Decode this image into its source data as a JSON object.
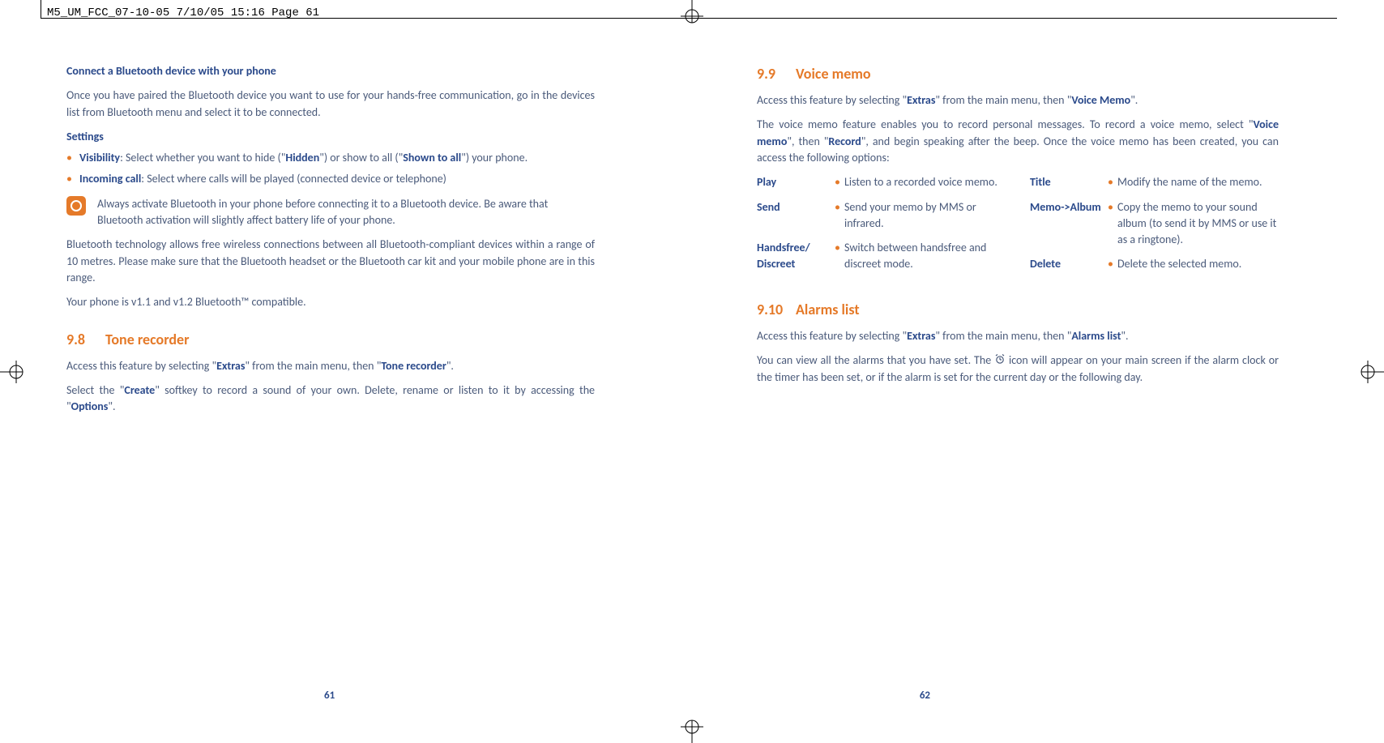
{
  "header": "M5_UM_FCC_07-10-05  7/10/05  15:16  Page 61",
  "left": {
    "h_connect": "Connect a Bluetooth device with your phone",
    "p_connect": "Once you have paired the Bluetooth device you want to use for your hands-free communication, go in the devices list from Bluetooth menu and select it to be connected.",
    "h_settings": "Settings",
    "vis_label": "Visibility",
    "vis_txt1": ": Select whether you want to hide (\"",
    "vis_hidden": "Hidden",
    "vis_txt2": "\") or show to all (\"",
    "vis_shown": "Shown to all",
    "vis_txt3": "\") your phone.",
    "inc_label": "Incoming call",
    "inc_txt": ": Select where calls will be played (connected device or telephone)",
    "tip": "Always activate Bluetooth in your phone before connecting it to a Bluetooth device. Be aware that Bluetooth activation will slightly affect battery life of your phone.",
    "p_bt_range": "Bluetooth technology allows free wireless connections between all Bluetooth-compliant devices within a range of 10 metres. Please make sure that the Bluetooth headset or the Bluetooth car kit and your mobile phone are in this range.",
    "p_bt_ver": "Your phone is v1.1 and v1.2 Bluetooth™ compatible.",
    "sec98_num": "9.8",
    "sec98_title": "Tone recorder",
    "tr_access_1": "Access this feature by selecting \"",
    "tr_extras": "Extras",
    "tr_access_2": "\" from the main menu, then \"",
    "tr_name": "Tone recorder",
    "tr_access_3": "\".",
    "tr_select_1": "Select the \"",
    "tr_create": "Create",
    "tr_select_2": "\" softkey to record a sound of your own. Delete, rename or listen to it by accessing the \"",
    "tr_options": "Options",
    "tr_select_3": "\".",
    "pagenum": "61"
  },
  "right": {
    "sec99_num": "9.9",
    "sec99_title": "Voice memo",
    "vm_access_1": "Access this feature by selecting \"",
    "vm_extras": "Extras",
    "vm_access_2": "\" from the main menu, then \"",
    "vm_name": "Voice Memo",
    "vm_access_3": "\".",
    "vm_intro_1": "The voice memo feature enables you to record personal messages. To record a voice memo, select \"",
    "vm_voicememo": "Voice memo",
    "vm_intro_2": "\", then \"",
    "vm_record": "Record",
    "vm_intro_3": "\", and begin speaking after the beep. Once the voice memo has been created, you can access the following options:",
    "opts_left": [
      {
        "label": "Play",
        "desc": "Listen to a recorded voice memo."
      },
      {
        "label": "Send",
        "desc": "Send your memo by MMS or infrared."
      },
      {
        "label": "Handsfree/ Discreet",
        "desc": "Switch between handsfree and discreet mode."
      }
    ],
    "opts_right": [
      {
        "label": "Title",
        "desc": "Modify the name of the memo."
      },
      {
        "label": "Memo->Album",
        "desc": "Copy the memo to your sound album (to send it by MMS or use it as a ringtone)."
      },
      {
        "label": "Delete",
        "desc": "Delete the selected memo."
      }
    ],
    "sec910_num": "9.10",
    "sec910_title": "Alarms list",
    "al_access_1": "Access this feature by selecting \"",
    "al_extras": "Extras",
    "al_access_2": "\" from the main menu, then \"",
    "al_name": "Alarms list",
    "al_access_3": "\".",
    "al_body_1": "You can view all the alarms that you have set. The ",
    "al_body_2": " icon will appear on your main screen if the alarm clock or the timer has been set, or if the alarm is set for the current day or the following day.",
    "pagenum": "62"
  }
}
